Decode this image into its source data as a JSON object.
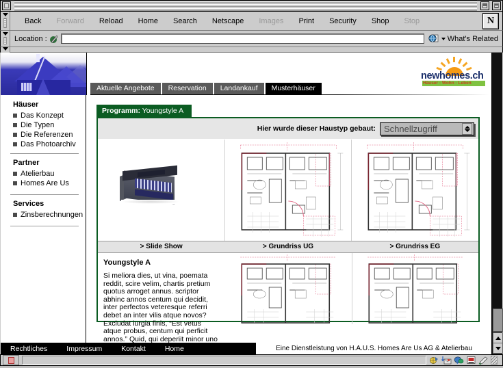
{
  "window": {
    "title": "",
    "close_box": "close-box",
    "zoom_box": "zoom-box",
    "collapse_box": "collapse-box"
  },
  "toolbar": {
    "buttons": [
      {
        "label": "Back",
        "enabled": true
      },
      {
        "label": "Forward",
        "enabled": false
      },
      {
        "label": "Reload",
        "enabled": true
      },
      {
        "label": "Home",
        "enabled": true
      },
      {
        "label": "Search",
        "enabled": true
      },
      {
        "label": "Netscape",
        "enabled": true
      },
      {
        "label": "Images",
        "enabled": false
      },
      {
        "label": "Print",
        "enabled": true
      },
      {
        "label": "Security",
        "enabled": true
      },
      {
        "label": "Shop",
        "enabled": true
      },
      {
        "label": "Stop",
        "enabled": false
      }
    ],
    "brand_logo": "N"
  },
  "location_bar": {
    "label": "Location :",
    "url_value": "",
    "url_placeholder": "",
    "whats_related": "What's Related"
  },
  "site_header": {
    "tabs": [
      {
        "label": "Aktuelle Angebote",
        "active": false
      },
      {
        "label": "Reservation",
        "active": false
      },
      {
        "label": "Landankauf",
        "active": false
      },
      {
        "label": "Musterhäuser",
        "active": true
      }
    ],
    "logo_name": "newhomes.ch",
    "logo_tagline": "Häuser - Wohn - Leben"
  },
  "sidebar": {
    "groups": [
      {
        "heading": "Häuser",
        "items": [
          "Das Konzept",
          "Die Typen",
          "Die Referenzen",
          "Das Photoarchiv"
        ]
      },
      {
        "heading": "Partner",
        "items": [
          "Atelierbau",
          "Homes Are Us"
        ]
      },
      {
        "heading": "Services",
        "items": [
          "Zinsberechnungen"
        ]
      }
    ]
  },
  "main": {
    "program_label": "Programm:",
    "program_value": "Youngstyle A",
    "hint_label": "Hier wurde dieser Haustyp gebaut:",
    "quick_select": {
      "selected": "Schnellzugriff",
      "options": [
        "Schnellzugriff"
      ]
    },
    "captions": [
      "> Slide Show",
      "> Grundriss UG",
      "> Grundriss EG"
    ],
    "article_title": "Youngstyle A",
    "article_body": "Si meliora dies, ut vina, poemata reddit, scire velim, chartis pretium quotus arroget annus. scriptor abhinc annos centum qui decidit, inter perfectos veteresque referri debet an inter vilis atque novos? Excludat iurgia finis, “Est vetus atque probus, centum qui perficit annos.” Quid, qui deperiit minor uno"
  },
  "footer": {
    "links": [
      "Rechtliches",
      "Impressum",
      "Kontakt",
      "Home"
    ],
    "note": "Eine Dienstleistung von H.A.U.S. Homes Are Us AG & Atelierbau"
  },
  "status_bar": {
    "security": "unlocked-padlock",
    "components": [
      "navigator-icon",
      "mailbox-icon",
      "instant-messenger-icon",
      "composer-icon",
      "preferences-icon"
    ]
  },
  "colors": {
    "accent_green": "#0b5c22",
    "tab_active": "#000000",
    "tab_inactive": "#5a5a5a",
    "logo_blue": "#1b2f6b",
    "logo_orange": "#f5a623",
    "logo_green": "#7fc241",
    "chrome_gray": "#cccccc"
  }
}
